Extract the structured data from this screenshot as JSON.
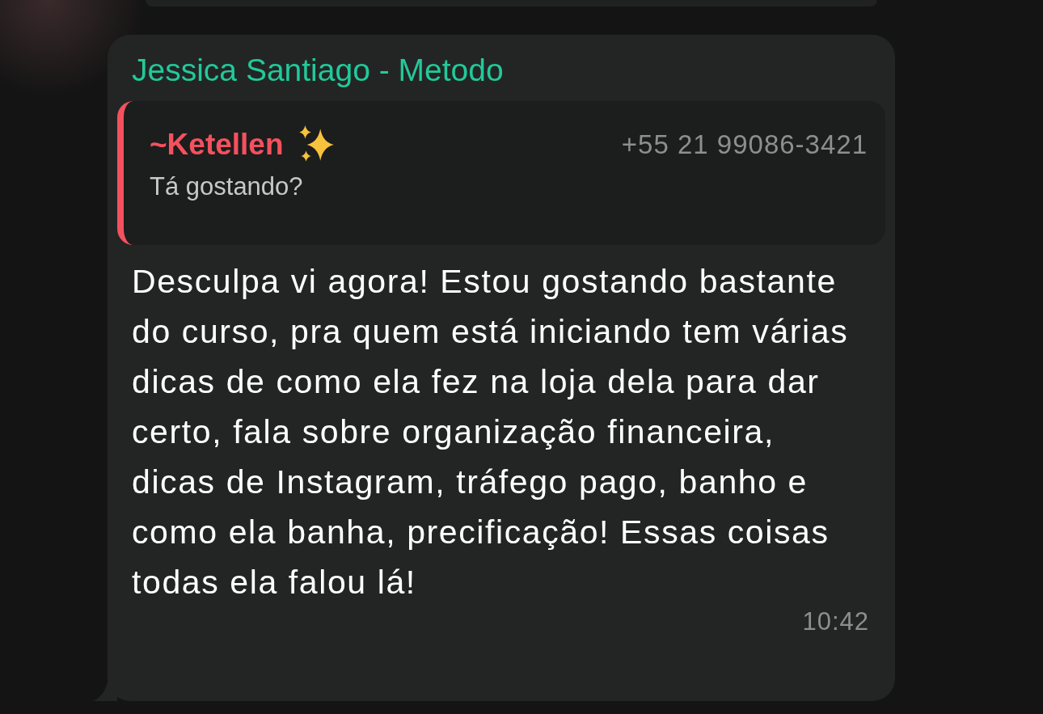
{
  "message": {
    "sender": "Jessica Santiago - Metodo",
    "quote": {
      "author": "~Ketellen",
      "phone": "+55 21 99086-3421",
      "text": "Tá gostando?"
    },
    "text": "Desculpa vi agora! Estou gostando bastante do curso, pra quem está iniciando tem várias dicas de como ela fez na loja dela para dar certo, fala sobre organização financeira, dicas de Instagram, tráfego pago, banho e como ela banha, precificação! Essas coisas todas ela falou lá!",
    "time": "10:42"
  }
}
